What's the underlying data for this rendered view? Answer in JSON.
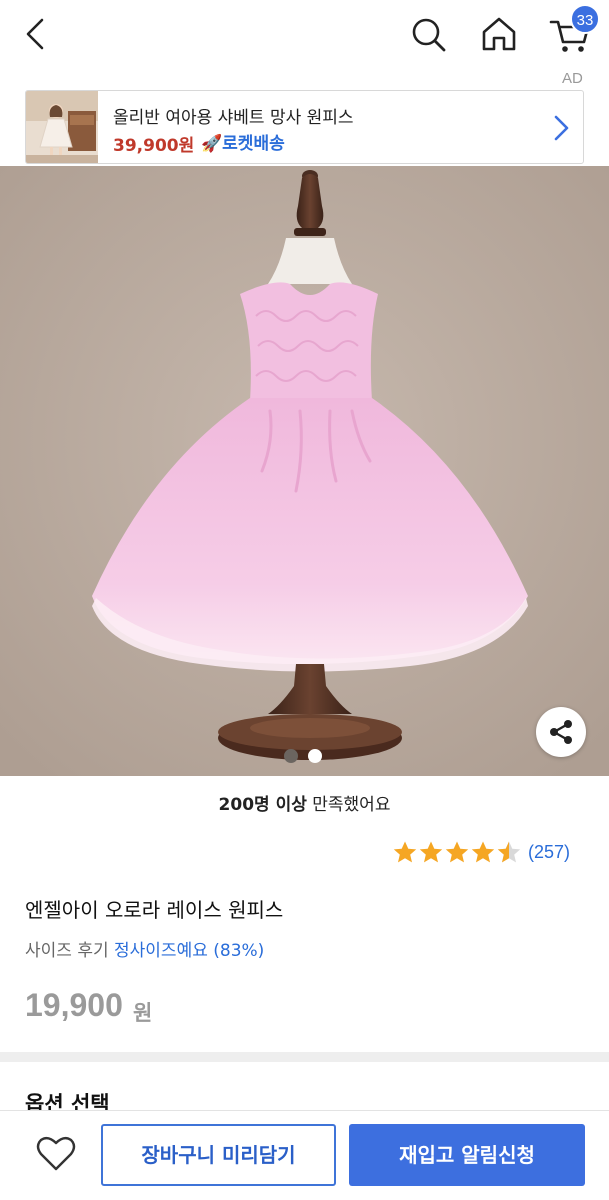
{
  "header": {
    "cart_count": "33",
    "ad_tag": "AD"
  },
  "ad": {
    "title": "올리반 여아용 샤베트 망사 원피스",
    "price": "39,900원",
    "delivery": "로켓배송"
  },
  "gallery": {
    "current_index": 1,
    "total": 2
  },
  "satisfaction": {
    "bold": "200명 이상",
    "rest": " 만족했어요"
  },
  "rating": {
    "stars": 4.5,
    "count": "(257)"
  },
  "product": {
    "name": "엔젤아이 오로라 레이스 원피스",
    "size_label": "사이즈 후기 ",
    "size_value": "정사이즈예요 (83%)",
    "price": "19,900",
    "price_unit": "원"
  },
  "options": {
    "title": "옵션 선택"
  },
  "actions": {
    "cart_button": "장바구니 미리담기",
    "notify_button": "재입고 알림신청"
  },
  "colors": {
    "accent": "#3d6fdf",
    "price_red": "#c0392b",
    "star": "#f5a623",
    "hero_bg": "#b8a99d",
    "dress": "#f3c4e3"
  }
}
